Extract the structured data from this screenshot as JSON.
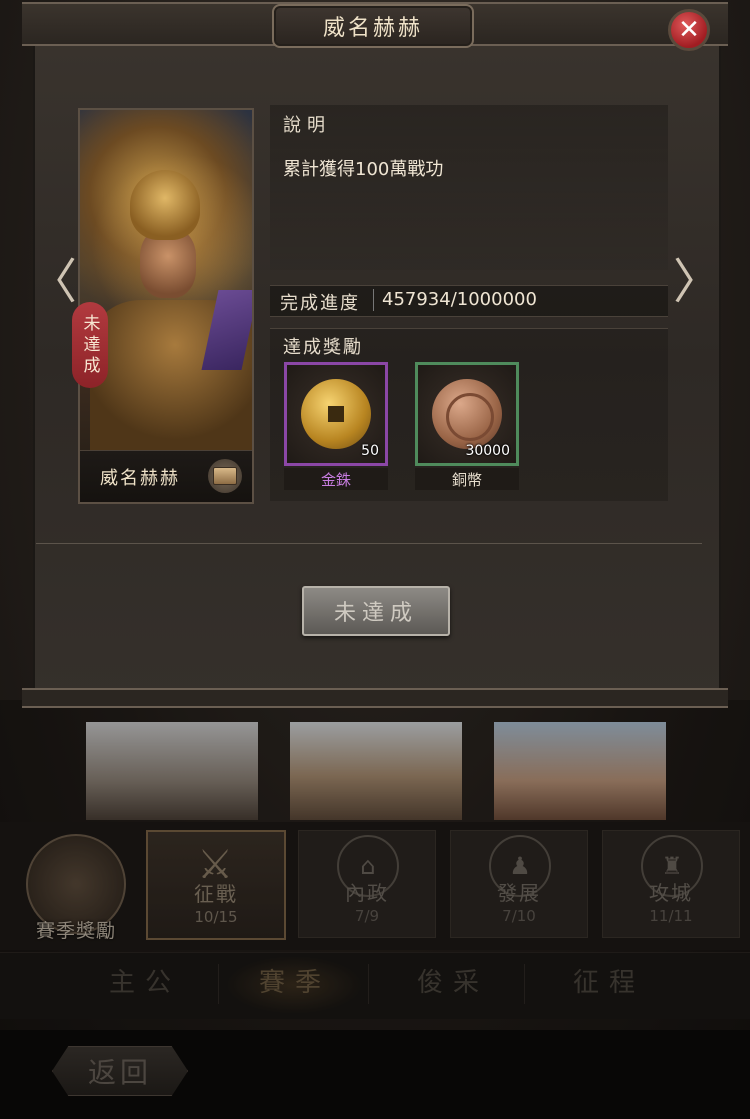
{
  "modal": {
    "title": "威名赫赫",
    "close_glyph": "✕",
    "arrow_left_glyph": "〈",
    "arrow_right_glyph": "〉",
    "hero": {
      "name": "威名赫赫",
      "status_tag": "未達成"
    },
    "description": {
      "label": "說明",
      "text": "累計獲得100萬戰功"
    },
    "progress": {
      "label": "完成進度",
      "value": "457934/1000000"
    },
    "rewards": {
      "label": "達成獎勵",
      "items": [
        {
          "name": "金銖",
          "count": "50",
          "icon": "gold-coin-icon",
          "rarity_color": "#8b47a6"
        },
        {
          "name": "銅幣",
          "count": "30000",
          "icon": "copper-coin-icon",
          "rarity_color": "#4f8b5c"
        }
      ]
    },
    "status_button": "未達成"
  },
  "background": {
    "season_reward_label": "賽季獎勵",
    "categories": [
      {
        "name": "征戰",
        "count": "10/15",
        "icon": "crossed-swords-icon",
        "glyph": "⚔",
        "active": true
      },
      {
        "name": "內政",
        "count": "7/9",
        "icon": "gate-icon",
        "glyph": "⌂",
        "active": false
      },
      {
        "name": "發展",
        "count": "7/10",
        "icon": "soldier-icon",
        "glyph": "♟",
        "active": false
      },
      {
        "name": "攻城",
        "count": "11/11",
        "icon": "castle-icon",
        "glyph": "♜",
        "active": false
      }
    ],
    "main_tabs": [
      "主公",
      "賽季",
      "俊采",
      "征程"
    ],
    "back_label": "返回"
  },
  "colors": {
    "accent_gold": "#efe2c8",
    "status_red": "#b23a3f",
    "close_red": "#c0392b"
  }
}
